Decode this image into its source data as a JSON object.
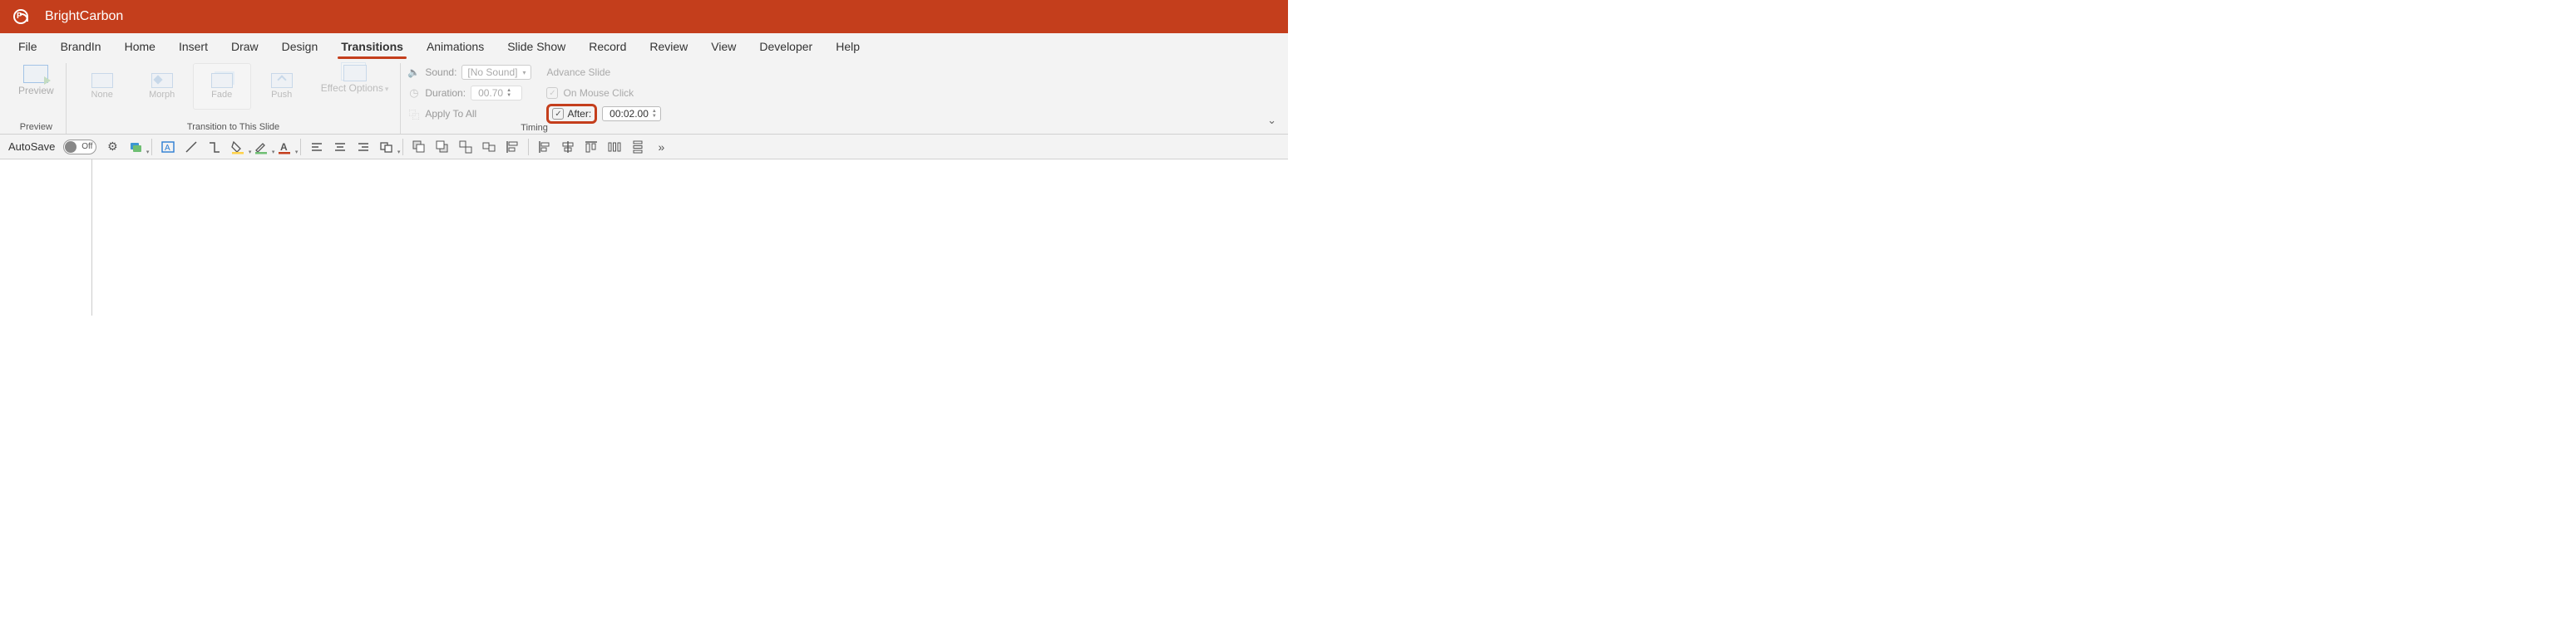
{
  "title": "BrightCarbon",
  "tabs": [
    "File",
    "BrandIn",
    "Home",
    "Insert",
    "Draw",
    "Design",
    "Transitions",
    "Animations",
    "Slide Show",
    "Record",
    "Review",
    "View",
    "Developer",
    "Help"
  ],
  "active_tab": "Transitions",
  "preview": {
    "label": "Preview",
    "group": "Preview"
  },
  "transition_group": "Transition to This Slide",
  "gallery": [
    {
      "label": "None"
    },
    {
      "label": "Morph"
    },
    {
      "label": "Fade"
    },
    {
      "label": "Push"
    }
  ],
  "effect_options": "Effect\nOptions",
  "timing": {
    "group": "Timing",
    "sound_label": "Sound:",
    "sound_value": "[No Sound]",
    "duration_label": "Duration:",
    "duration_value": "00.70",
    "apply_all": "Apply To All",
    "advance_head": "Advance Slide",
    "on_click": "On Mouse Click",
    "after_label": "After:",
    "after_value": "00:02.00"
  },
  "qat": {
    "autosave": "AutoSave",
    "toggle": "Off",
    "more": "»"
  }
}
